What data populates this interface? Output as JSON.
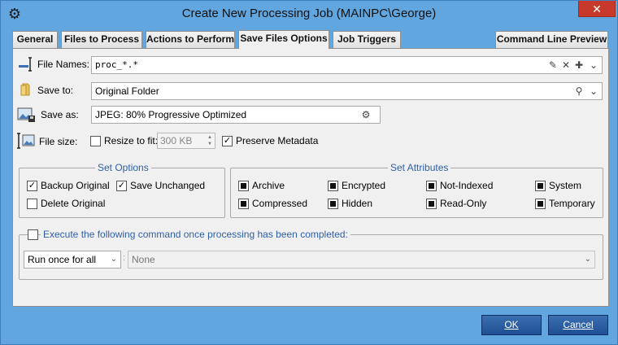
{
  "window": {
    "title": "Create New Processing Job (MAINPC\\George)",
    "close_glyph": "✕"
  },
  "tabs": [
    {
      "label": "General"
    },
    {
      "label": "Files to Process"
    },
    {
      "label": "Actions to Perform"
    },
    {
      "label": "Save Files Options"
    },
    {
      "label": "Job Triggers"
    },
    {
      "label": "Command Line Preview"
    }
  ],
  "file_names": {
    "label": "File Names:",
    "value": "proc_*.*"
  },
  "save_to": {
    "label": "Save to:",
    "value": "Original Folder"
  },
  "save_as": {
    "label": "Save as:",
    "value": "JPEG: 80%  Progressive Optimized"
  },
  "file_size": {
    "label": "File size:",
    "resize_label": "Resize to fit:",
    "resize_value": "300 KB",
    "preserve_label": "Preserve Metadata"
  },
  "set_options": {
    "title": "Set Options",
    "backup_label": "Backup Original",
    "save_unchanged_label": "Save Unchanged",
    "delete_label": "Delete Original"
  },
  "set_attributes": {
    "title": "Set Attributes",
    "items": [
      {
        "label": "Archive"
      },
      {
        "label": "Encrypted"
      },
      {
        "label": "Not-Indexed"
      },
      {
        "label": "System"
      },
      {
        "label": "Compressed"
      },
      {
        "label": "Hidden"
      },
      {
        "label": "Read-Only"
      },
      {
        "label": "Temporary"
      }
    ]
  },
  "command": {
    "label": "Execute the following command once processing has been completed:",
    "run_mode": "Run once for all",
    "command_value": "None"
  },
  "buttons": {
    "ok": "OK",
    "cancel": "Cancel"
  }
}
